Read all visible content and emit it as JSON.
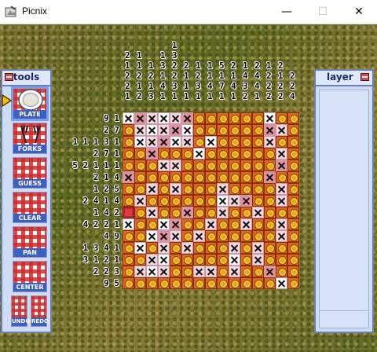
{
  "window": {
    "title": "Picnix",
    "min_glyph": "—",
    "max_glyph": "☐",
    "close_glyph": "✕"
  },
  "tools_panel": {
    "title": "tools",
    "items": [
      {
        "label": "PLATE",
        "selected": true
      },
      {
        "label": "FORKS"
      },
      {
        "label": "GUESS"
      },
      {
        "label": "CLEAR"
      },
      {
        "label": "PAN"
      },
      {
        "label": "CENTER"
      }
    ],
    "undo": "UNDO",
    "redo": "REDO"
  },
  "layer_panel": {
    "title": "layer"
  },
  "column_clues": [
    [
      "2",
      "1",
      "2",
      "2",
      "1"
    ],
    [
      "1",
      "1",
      "2",
      "1",
      "2"
    ],
    [
      "1",
      "2",
      "1",
      "3"
    ],
    [
      "1",
      "3",
      "1",
      "4",
      "1"
    ],
    [
      "1",
      "3",
      "2",
      "2",
      "3",
      "1"
    ],
    [
      "2",
      "1",
      "1",
      "1"
    ],
    [
      "1",
      "2",
      "3",
      "1"
    ],
    [
      "1",
      "1",
      "4",
      "1"
    ],
    [
      "5",
      "1",
      "7",
      "1"
    ],
    [
      "2",
      "1",
      "4",
      "1"
    ],
    [
      "1",
      "4",
      "3",
      "2"
    ],
    [
      "2",
      "4",
      "4",
      "1"
    ],
    [
      "1",
      "2",
      "2",
      "2"
    ],
    [
      "2",
      "1",
      "2",
      "2"
    ],
    [
      "2",
      "2",
      "4"
    ]
  ],
  "row_clues": [
    [
      "9",
      "1"
    ],
    [
      "2",
      "7"
    ],
    [
      "1",
      "1",
      "1",
      "3",
      "1"
    ],
    [
      "2",
      "7",
      "1"
    ],
    [
      "5",
      "2",
      "1",
      "1",
      "1"
    ],
    [
      "2",
      "1",
      "4"
    ],
    [
      "1",
      "2",
      "5"
    ],
    [
      "2",
      "4",
      "1",
      "4"
    ],
    [
      "1",
      "4",
      "2"
    ],
    [
      "4",
      "2",
      "2",
      "1"
    ],
    [
      "4",
      "9"
    ],
    [
      "1",
      "3",
      "4",
      "1"
    ],
    [
      "3",
      "1",
      "2",
      "1"
    ],
    [
      "2",
      "2",
      "3"
    ],
    [
      "9",
      "5"
    ]
  ],
  "board": [
    "XXXXXXOOOOOOXOO",
    "OXXXXXOOOOOOXXO",
    "OXXXXXOXOOOOXOO",
    "OOXOOOXOOOOOOXO",
    "OOOXXOOOOOOOOXO",
    "XOOOOOOOOOOOXOO",
    "OOXOXOOOXOOOOXO",
    "OXOOOOOOXXXOOXO",
    "FOXOOXOOXOOXOOO",
    "XOOXXOOXOOXOOXO",
    "OOXXXOXOOOOOOXO",
    "OXOXOXOOOXOXOOO",
    "OOXXOOOOOXOXOOO",
    "OXXXOOXXOXOOXOO",
    "OOOOOOOOOOOOOXO"
  ],
  "colors": {
    "panel_border": "#6a7fb8",
    "plate_orange": "#e0661d",
    "plate_yellow": "#f2c62f",
    "label_blue": "#3d5fc4"
  }
}
